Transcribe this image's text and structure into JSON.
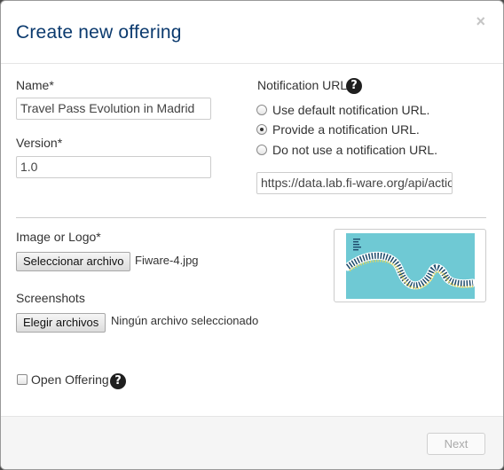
{
  "header": {
    "title": "Create new offering",
    "close_label": "×"
  },
  "form": {
    "name_label": "Name*",
    "name_value": "Travel Pass Evolution in Madrid",
    "version_label": "Version*",
    "version_value": "1.0",
    "notification_label": "Notification URL*",
    "help_glyph": "?",
    "notification_options": [
      {
        "label": "Use default notification URL.",
        "checked": false
      },
      {
        "label": "Provide a notification URL.",
        "checked": true
      },
      {
        "label": "Do not use a notification URL.",
        "checked": false
      }
    ],
    "notification_url_value": "https://data.lab.fi-ware.org/api/action",
    "image_label": "Image or Logo*",
    "image_button": "Seleccionar archivo",
    "image_file": "Fiware-4.jpg",
    "screenshots_label": "Screenshots",
    "screenshots_button": "Elegir archivos",
    "screenshots_file": "Ningún archivo seleccionado",
    "open_offering_label": "Open Offering",
    "open_offering_checked": false
  },
  "footer": {
    "next_label": "Next"
  },
  "colors": {
    "title": "#0b3a6e",
    "logo_background": "#6fc9d4"
  }
}
